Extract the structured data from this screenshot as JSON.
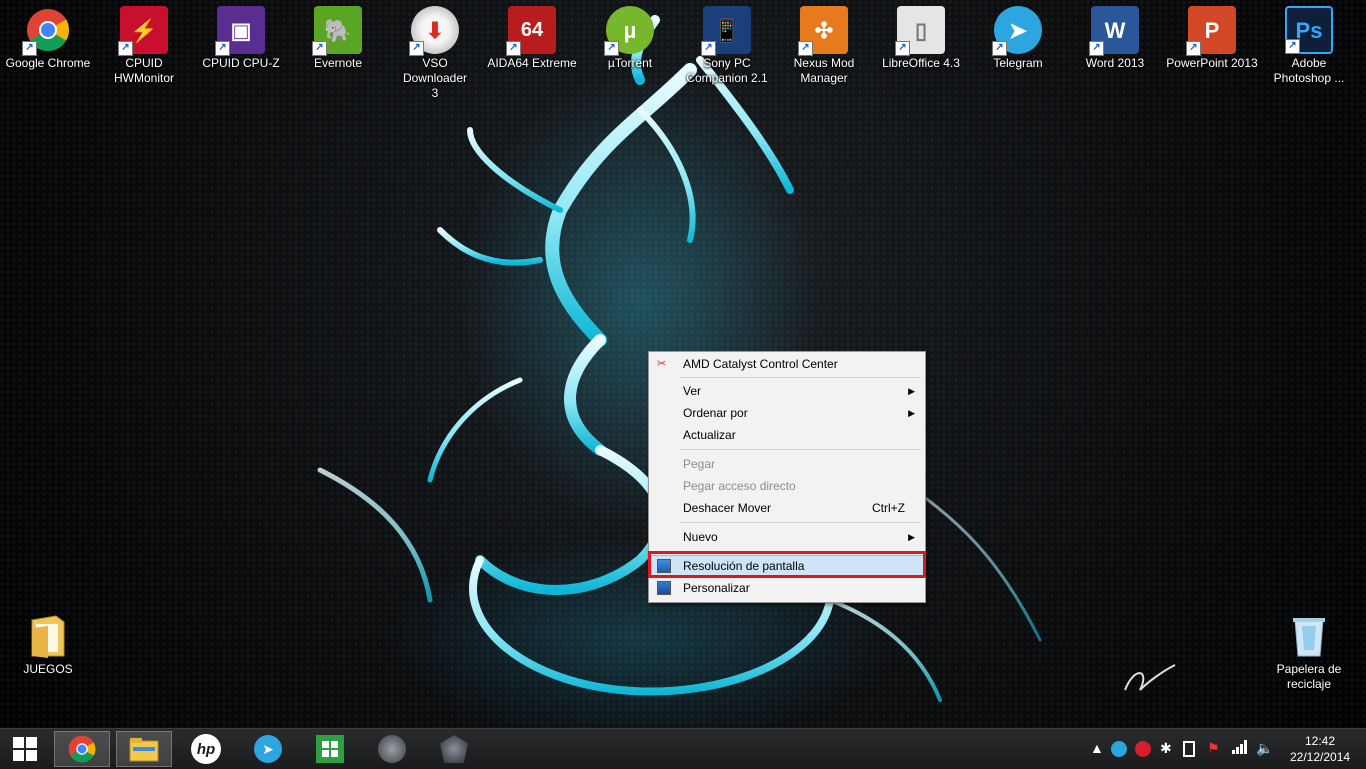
{
  "desktop_icons": [
    {
      "label": "Google Chrome",
      "icon": "chrome-icon",
      "color": "#e8453c"
    },
    {
      "label": "CPUID\nHWMonitor",
      "icon": "hwmonitor-icon",
      "color": "#c8102e"
    },
    {
      "label": "CPUID CPU-Z",
      "icon": "cpuz-icon",
      "color": "#5a2d91"
    },
    {
      "label": "Evernote",
      "icon": "evernote-icon",
      "color": "#5ba525"
    },
    {
      "label": "VSO Downloader\n3",
      "icon": "vso-downloader-icon",
      "color": "#d92b1e"
    },
    {
      "label": "AIDA64 Extreme",
      "icon": "aida64-icon",
      "color": "#b81c1c"
    },
    {
      "label": "µTorrent",
      "icon": "utorrent-icon",
      "color": "#77b72b"
    },
    {
      "label": "Sony PC\nCompanion 2.1",
      "icon": "sony-pc-companion-icon",
      "color": "#2a6db8"
    },
    {
      "label": "Nexus Mod\nManager",
      "icon": "nexus-mod-manager-icon",
      "color": "#e87a1e"
    },
    {
      "label": "LibreOffice 4.3",
      "icon": "libreoffice-icon",
      "color": "#e5e5e5"
    },
    {
      "label": "Telegram",
      "icon": "telegram-icon",
      "color": "#2ca5e0"
    },
    {
      "label": "Word 2013",
      "icon": "word-icon",
      "color": "#2b579a"
    },
    {
      "label": "PowerPoint 2013",
      "icon": "powerpoint-icon",
      "color": "#d24726"
    },
    {
      "label": "Adobe\nPhotoshop ...",
      "icon": "photoshop-icon",
      "color": "#0d1f39"
    }
  ],
  "folder_juegos": {
    "label": "JUEGOS",
    "icon": "folder-icon"
  },
  "recycle_bin": {
    "label": "Papelera de\nreciclaje",
    "icon": "recycle-bin-icon"
  },
  "context_menu": {
    "amd": "AMD Catalyst Control Center",
    "ver": "Ver",
    "ordenar": "Ordenar por",
    "actualizar": "Actualizar",
    "pegar": "Pegar",
    "pegar_acceso": "Pegar acceso directo",
    "deshacer": "Deshacer Mover",
    "deshacer_shortcut": "Ctrl+Z",
    "nuevo": "Nuevo",
    "resolucion": "Resolución de pantalla",
    "personalizar": "Personalizar"
  },
  "taskbar": {
    "pinned": [
      "start-button",
      "chrome-icon",
      "file-explorer-icon",
      "hp-icon",
      "telegram-icon",
      "store-icon",
      "game-icon-1",
      "game-icon-2"
    ],
    "time": "12:42",
    "date": "22/12/2014"
  },
  "colors": {
    "highlight_border": "#e0161e",
    "menu_bg": "#f2f2f2",
    "hover_bg": "#cfe4f7"
  }
}
